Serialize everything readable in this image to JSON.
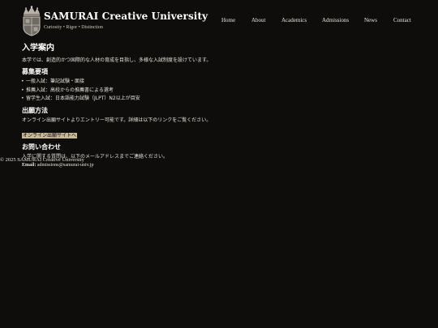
{
  "header": {
    "title": "SAMURAI Creative University",
    "tagline": "Curiosity • Rigor • Distinction",
    "logo_icon": "crest-logo-icon"
  },
  "nav": {
    "items": [
      {
        "label": "Home"
      },
      {
        "label": "About"
      },
      {
        "label": "Academics"
      },
      {
        "label": "Admissions"
      },
      {
        "label": "News"
      },
      {
        "label": "Contact"
      }
    ]
  },
  "main": {
    "title": "入学案内",
    "intro": "本学では、創造的かつ国際的な人材の育成を目指し、多様な入試制度を設けています。",
    "requirements": {
      "heading": "募集要項",
      "items": [
        "一般入試：筆記試験・面接",
        "推薦入試：高校からの推薦書による選考",
        "留学生入試：日本語能力試験（JLPT）N2以上が目安"
      ]
    },
    "application": {
      "heading": "出願方法",
      "text": "オンライン出願サイトよりエントリー可能です。詳細は以下のリンクをご覧ください。",
      "link_label": "オンライン出願サイトへ"
    },
    "contact": {
      "heading": "お問い合わせ",
      "text": "入学に関する質問は、以下のメールアドレスまでご連絡ください。",
      "email_label": "Email:",
      "email": "admissions@samurai-univ.jp"
    }
  },
  "footer": {
    "copyright": "© 2025 SAMURAI Creative University"
  },
  "colors": {
    "background": "#0f0d0b",
    "link_button_bg": "#c8b89a",
    "text": "#eeeae4"
  }
}
